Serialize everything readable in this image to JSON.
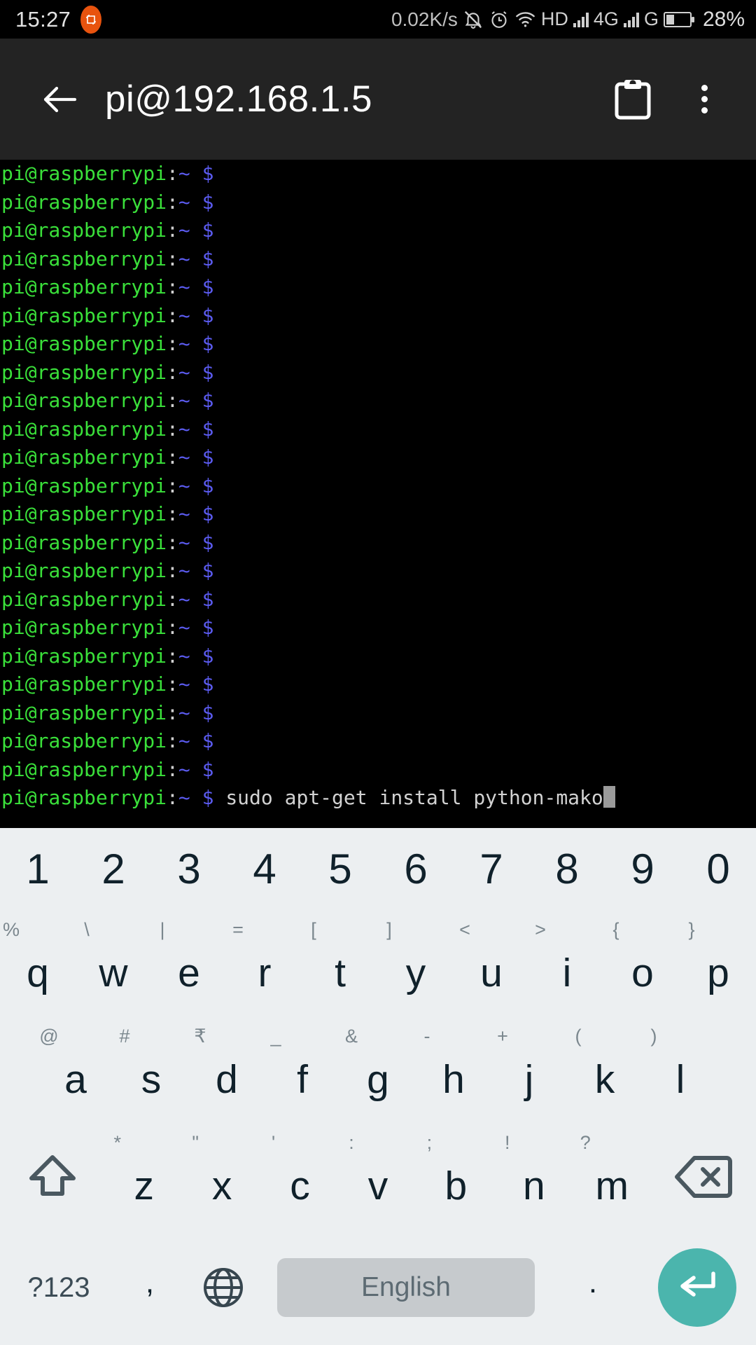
{
  "status_bar": {
    "time": "15:27",
    "app_badge_icon": "app-crop-icon",
    "network_speed": "0.02K/s",
    "icons": [
      "bell-muted-icon",
      "alarm-clock-icon",
      "wifi-icon"
    ],
    "hd_label": "HD",
    "signal_icon_1": "signal-bars-icon",
    "network_type": "4G",
    "signal_icon_2": "signal-bars-icon",
    "secondary_network": "G",
    "battery_icon": "battery-icon",
    "battery_percent": "28%"
  },
  "app_bar": {
    "back_icon": "back-arrow-icon",
    "title": "pi@192.168.1.5",
    "clipboard_icon": "clipboard-icon",
    "overflow_icon": "more-vertical-icon"
  },
  "terminal": {
    "prompt_user_host": "pi@raspberrypi",
    "prompt_colon": ":",
    "prompt_path": "~",
    "prompt_symbol": "$",
    "blank_prompt_count": 22,
    "command": "sudo apt-get install python-mako",
    "cursor": "block-cursor",
    "colors": {
      "host": "#3ae03a",
      "path": "#5b5bf0",
      "dollar": "#5b5bf0",
      "command": "#d2d2d2",
      "background": "#000000",
      "cursor": "#9a9a9a"
    }
  },
  "keyboard": {
    "background_color": "#eceff1",
    "accent_color": "#4bb5ad",
    "rows": {
      "numbers": [
        {
          "main": "1",
          "sup": ""
        },
        {
          "main": "2",
          "sup": ""
        },
        {
          "main": "3",
          "sup": ""
        },
        {
          "main": "4",
          "sup": ""
        },
        {
          "main": "5",
          "sup": ""
        },
        {
          "main": "6",
          "sup": ""
        },
        {
          "main": "7",
          "sup": ""
        },
        {
          "main": "8",
          "sup": ""
        },
        {
          "main": "9",
          "sup": ""
        },
        {
          "main": "0",
          "sup": ""
        }
      ],
      "top": [
        {
          "main": "q",
          "sup": "%"
        },
        {
          "main": "w",
          "sup": "\\"
        },
        {
          "main": "e",
          "sup": "|"
        },
        {
          "main": "r",
          "sup": "="
        },
        {
          "main": "t",
          "sup": "["
        },
        {
          "main": "y",
          "sup": "]"
        },
        {
          "main": "u",
          "sup": "<"
        },
        {
          "main": "i",
          "sup": ">"
        },
        {
          "main": "o",
          "sup": "{"
        },
        {
          "main": "p",
          "sup": "}"
        }
      ],
      "home": [
        {
          "main": "a",
          "sup": "@"
        },
        {
          "main": "s",
          "sup": "#"
        },
        {
          "main": "d",
          "sup": "₹"
        },
        {
          "main": "f",
          "sup": "_"
        },
        {
          "main": "g",
          "sup": "&"
        },
        {
          "main": "h",
          "sup": "-"
        },
        {
          "main": "j",
          "sup": "+"
        },
        {
          "main": "k",
          "sup": "("
        },
        {
          "main": "l",
          "sup": ")"
        }
      ],
      "bottom": [
        {
          "main": "z",
          "sup": "*"
        },
        {
          "main": "x",
          "sup": "\""
        },
        {
          "main": "c",
          "sup": "'"
        },
        {
          "main": "v",
          "sup": ":"
        },
        {
          "main": "b",
          "sup": ";"
        },
        {
          "main": "n",
          "sup": "!"
        },
        {
          "main": "m",
          "sup": "?"
        }
      ]
    },
    "shift_icon": "shift-up-arrow-icon",
    "backspace_icon": "backspace-icon",
    "symbols_key": "?123",
    "comma_key": ",",
    "globe_icon": "globe-language-icon",
    "spacebar_label": "English",
    "period_key": ".",
    "enter_icon": "enter-return-icon"
  }
}
